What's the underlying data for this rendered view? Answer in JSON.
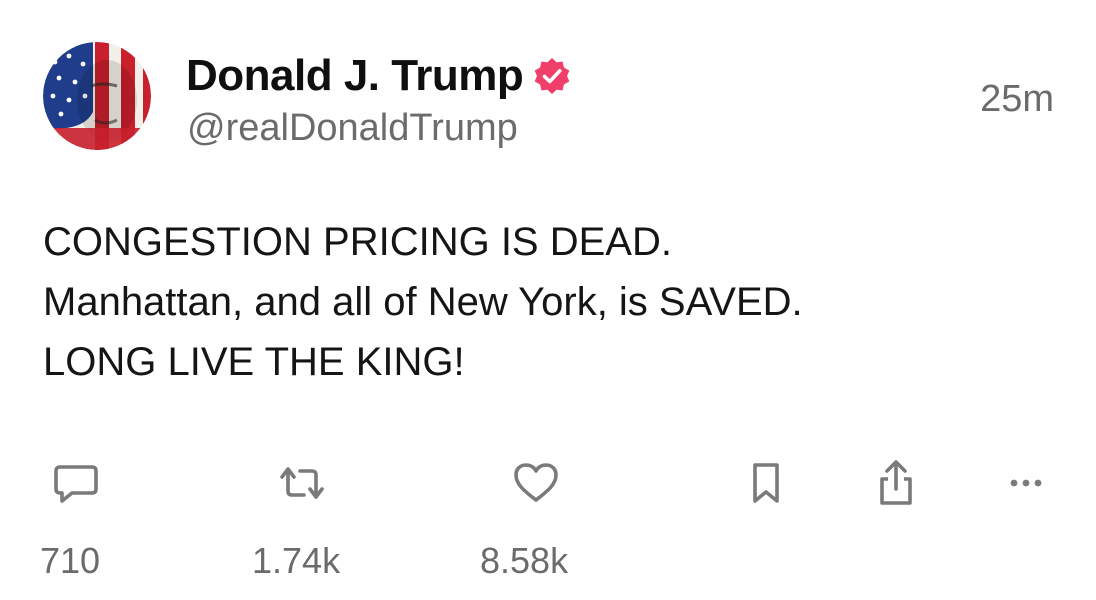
{
  "post": {
    "author": {
      "display_name": "Donald J. Trump",
      "handle": "@realDonaldTrump",
      "verified": true,
      "verified_color": "#f0406a"
    },
    "timestamp": "25m",
    "text_lines": [
      "CONGESTION PRICING IS DEAD.",
      "Manhattan, and all of New York, is SAVED.",
      "LONG LIVE THE KING!"
    ],
    "actions": {
      "reply": {
        "icon": "reply-icon",
        "count": "710"
      },
      "repost": {
        "icon": "repost-icon",
        "count": "1.74k"
      },
      "like": {
        "icon": "heart-icon",
        "count": "8.58k"
      },
      "bookmark": {
        "icon": "bookmark-icon"
      },
      "share": {
        "icon": "share-icon"
      },
      "more": {
        "icon": "more-icon"
      }
    },
    "icon_color": "#7a7a7a"
  }
}
